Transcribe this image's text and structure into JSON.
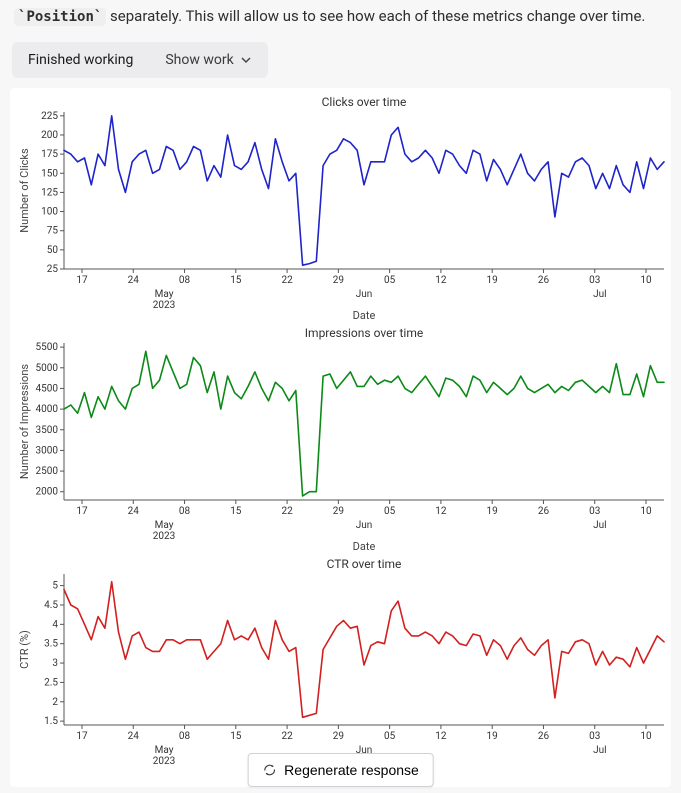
{
  "intro": {
    "code_word": "Position",
    "rest": "separately. This will allow us to see how each of these metrics change over time."
  },
  "workbar": {
    "status": "Finished working",
    "show_label": "Show work"
  },
  "regen_label": "Regenerate response",
  "x_axis": {
    "label": "Date",
    "ticks": [
      "17",
      "24",
      "08",
      "15",
      "22",
      "29",
      "05",
      "12",
      "19",
      "26",
      "03",
      "10"
    ],
    "month_markers": [
      {
        "label_top": "May",
        "label_bottom": "2023",
        "at_index": 1.6
      },
      {
        "label_top": "Jun",
        "label_bottom": "",
        "at_index": 5.5
      },
      {
        "label_top": "Jul",
        "label_bottom": "",
        "at_index": 10.1
      }
    ]
  },
  "chart_data": [
    {
      "type": "line",
      "title": "Clicks over time",
      "xlabel": "Date",
      "ylabel": "Number of Clicks",
      "color": "#1e24c9",
      "ylim": [
        25,
        230
      ],
      "yticks": [
        25,
        50,
        75,
        100,
        125,
        150,
        175,
        200,
        225
      ],
      "values": [
        180,
        175,
        165,
        170,
        135,
        175,
        160,
        225,
        155,
        125,
        165,
        175,
        180,
        150,
        155,
        185,
        180,
        155,
        165,
        185,
        180,
        140,
        160,
        145,
        200,
        160,
        155,
        165,
        190,
        155,
        130,
        195,
        165,
        140,
        150,
        30,
        32,
        35,
        160,
        175,
        180,
        195,
        190,
        180,
        135,
        165,
        165,
        165,
        200,
        210,
        175,
        165,
        170,
        180,
        170,
        150,
        180,
        175,
        160,
        150,
        180,
        175,
        140,
        168,
        155,
        135,
        155,
        175,
        150,
        140,
        155,
        165,
        93,
        150,
        145,
        165,
        170,
        160,
        130,
        150,
        130,
        160,
        135,
        125,
        165,
        130,
        170,
        155,
        165
      ]
    },
    {
      "type": "line",
      "title": "Impressions over time",
      "xlabel": "Date",
      "ylabel": "Number of Impressions",
      "color": "#0b8a18",
      "ylim": [
        1800,
        5600
      ],
      "yticks": [
        2000,
        2500,
        3000,
        3500,
        4000,
        4500,
        5000,
        5500
      ],
      "values": [
        4000,
        4100,
        3900,
        4400,
        3800,
        4300,
        4000,
        4550,
        4200,
        4000,
        4500,
        4600,
        5400,
        4500,
        4700,
        5300,
        4900,
        4500,
        4600,
        5250,
        5050,
        4400,
        4900,
        4000,
        4800,
        4400,
        4250,
        4550,
        4900,
        4500,
        4200,
        4650,
        4500,
        4200,
        4450,
        1900,
        2000,
        2000,
        4800,
        4850,
        4500,
        4700,
        4900,
        4550,
        4550,
        4800,
        4600,
        4700,
        4650,
        4800,
        4500,
        4400,
        4600,
        4800,
        4550,
        4300,
        4750,
        4700,
        4550,
        4300,
        4800,
        4700,
        4400,
        4650,
        4500,
        4350,
        4500,
        4800,
        4500,
        4400,
        4500,
        4600,
        4400,
        4550,
        4450,
        4650,
        4700,
        4550,
        4400,
        4550,
        4400,
        5100,
        4350,
        4350,
        4850,
        4300,
        5050,
        4650,
        4650
      ]
    },
    {
      "type": "line",
      "title": "CTR over time",
      "xlabel": "Date",
      "ylabel": "CTR (%)",
      "color": "#d22020",
      "ylim": [
        1.4,
        5.3
      ],
      "yticks": [
        1.5,
        2.0,
        2.5,
        3.0,
        3.5,
        4.0,
        4.5,
        5.0
      ],
      "values": [
        4.9,
        4.5,
        4.4,
        4.0,
        3.6,
        4.2,
        3.9,
        5.1,
        3.8,
        3.1,
        3.7,
        3.8,
        3.4,
        3.3,
        3.3,
        3.6,
        3.6,
        3.5,
        3.6,
        3.6,
        3.6,
        3.1,
        3.3,
        3.5,
        4.1,
        3.6,
        3.7,
        3.6,
        3.9,
        3.4,
        3.1,
        4.1,
        3.6,
        3.3,
        3.4,
        1.6,
        1.65,
        1.7,
        3.35,
        3.65,
        3.95,
        4.1,
        3.9,
        3.95,
        2.95,
        3.45,
        3.55,
        3.5,
        4.35,
        4.6,
        3.9,
        3.7,
        3.7,
        3.8,
        3.7,
        3.5,
        3.8,
        3.7,
        3.5,
        3.45,
        3.75,
        3.7,
        3.2,
        3.6,
        3.45,
        3.1,
        3.45,
        3.65,
        3.35,
        3.2,
        3.45,
        3.6,
        2.1,
        3.3,
        3.25,
        3.55,
        3.6,
        3.5,
        2.95,
        3.3,
        2.95,
        3.15,
        3.1,
        2.9,
        3.4,
        3.0,
        3.35,
        3.7,
        3.55
      ]
    }
  ]
}
